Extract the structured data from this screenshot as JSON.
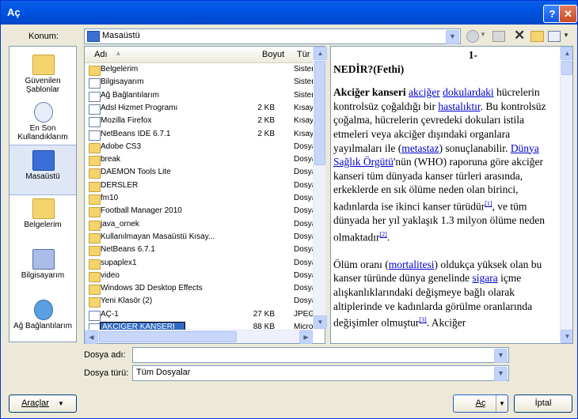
{
  "window": {
    "title": "Aç"
  },
  "lookin": {
    "label": "Konum:",
    "value": "Masaüstü"
  },
  "places": [
    {
      "label": "Güvenilen Şablonlar",
      "icon": "folder-icon"
    },
    {
      "label": "En Son Kullandıklarım",
      "icon": "recent-icon"
    },
    {
      "label": "Masaüstü",
      "icon": "desktop-icon"
    },
    {
      "label": "Belgelerim",
      "icon": "documents-icon"
    },
    {
      "label": "Bilgisayarım",
      "icon": "computer-icon"
    },
    {
      "label": "Ağ Bağlantılarım",
      "icon": "network-icon"
    }
  ],
  "columns": {
    "name": "Adı",
    "size": "Boyut",
    "type": "Tür"
  },
  "files": [
    {
      "name": "Belgelerim",
      "size": "",
      "type": "Sistem",
      "icon": "documents-icon"
    },
    {
      "name": "Bilgisayarım",
      "size": "",
      "type": "Sistem",
      "icon": "computer-icon"
    },
    {
      "name": "Ağ Bağlantılarım",
      "size": "",
      "type": "Sistem",
      "icon": "network-icon"
    },
    {
      "name": "Adsl Hizmet Programı",
      "size": "2 KB",
      "type": "Kısayol",
      "icon": "shortcut-icon"
    },
    {
      "name": "Mozilla Firefox",
      "size": "2 KB",
      "type": "Kısayol",
      "icon": "firefox-icon"
    },
    {
      "name": "NetBeans IDE 6.7.1",
      "size": "2 KB",
      "type": "Kısayol",
      "icon": "shortcut-icon"
    },
    {
      "name": "Adobe CS3",
      "size": "",
      "type": "Dosya",
      "icon": "folder-icon"
    },
    {
      "name": "break",
      "size": "",
      "type": "Dosya",
      "icon": "folder-icon"
    },
    {
      "name": "DAEMON Tools Lite",
      "size": "",
      "type": "Dosya",
      "icon": "folder-icon"
    },
    {
      "name": "DERSLER",
      "size": "",
      "type": "Dosya",
      "icon": "folder-icon"
    },
    {
      "name": "fm10",
      "size": "",
      "type": "Dosya",
      "icon": "folder-icon"
    },
    {
      "name": "Football Manager 2010",
      "size": "",
      "type": "Dosya",
      "icon": "app-icon"
    },
    {
      "name": "java_ornek",
      "size": "",
      "type": "Dosya",
      "icon": "folder-icon"
    },
    {
      "name": "Kullanılmayan Masaüstü Kısay...",
      "size": "",
      "type": "Dosya",
      "icon": "folder-icon"
    },
    {
      "name": "NetBeans 6.7.1",
      "size": "",
      "type": "Dosya",
      "icon": "folder-icon"
    },
    {
      "name": "supaplex1",
      "size": "",
      "type": "Dosya",
      "icon": "folder-icon"
    },
    {
      "name": "video",
      "size": "",
      "type": "Dosya",
      "icon": "folder-icon"
    },
    {
      "name": "Windows 3D Desktop Effects",
      "size": "",
      "type": "Dosya",
      "icon": "folder-icon"
    },
    {
      "name": "Yeni Klasör (2)",
      "size": "",
      "type": "Dosya",
      "icon": "folder-icon"
    },
    {
      "name": "AÇ-1",
      "size": "27 KB",
      "type": "JPEG",
      "icon": "image-icon"
    },
    {
      "name": "AKCİĞER KANSERİ",
      "size": "88 KB",
      "type": "Micro",
      "icon": "word-doc-icon",
      "editing": true
    }
  ],
  "preview": {
    "pagenum": "1-",
    "heading": "NEDİR?(Fethi)",
    "p1": {
      "b": "Akciğer kanseri",
      "a1": "akciğer",
      "a2": "dokulardaki",
      "t1": "hücrelerin kontrolsüz çoğaldığı bir",
      "a3": "hastalıktır",
      "t2": ". Bu kontrolsüz çoğalma, hücrelerin çevredeki dokuları istila etmeleri veya akciğer dışındaki organlara yayılmaları ile (",
      "a4": "metastaz",
      "t3": ") sonuçlanabilir.",
      "a5": "Dünya Sağlık Örgütü",
      "t4": "'nün (WHO) raporuna göre akciğer kanseri tüm dünyada kanser türleri arasında, erkeklerde en sık ölüme neden olan birinci, kadınlarda ise ikinci kanser türüdür",
      "ref1": "[1]",
      "t5": ", ve tüm dünyada her yıl yaklaşık 1.3 milyon ölüme neden olmaktadır",
      "ref2": "[2]",
      "t6": "."
    },
    "p2": {
      "t1": "Ölüm oranı (",
      "a1": "mortalitesi",
      "t2": ") oldukça yüksek olan bu kanser türünde dünya genelinde",
      "a2": "sigara",
      "t3": "içme alışkanlıklarındaki değişmeye bağlı olarak altiplerinde ve kadınlarda görülme oranlarında değişimler olmuştur",
      "ref3": "[3]",
      "t4": ". Akciğer"
    }
  },
  "filename": {
    "label": "Dosya adı:",
    "value": ""
  },
  "filetype": {
    "label": "Dosya türü:",
    "value": "Tüm Dosyalar"
  },
  "buttons": {
    "tools": "Araçlar",
    "open": "Aç",
    "cancel": "İptal"
  },
  "colors": {
    "title_bar": "#0054e3",
    "selection": "#316ac5",
    "link": "#0000cc"
  }
}
